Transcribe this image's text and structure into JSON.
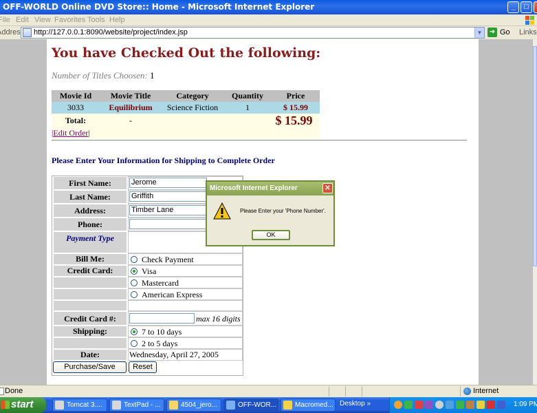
{
  "window": {
    "title": "OFF-WORLD Online DVD Store:: Home - Microsoft Internet Explorer"
  },
  "menu": [
    "File",
    "Edit",
    "View",
    "Favorites",
    "Tools",
    "Help"
  ],
  "address": {
    "label": "Address",
    "url": "http://127.0.0.1:8090/website/project/index.jsp",
    "go": "Go",
    "links": "Links"
  },
  "page": {
    "heading": "You have Checked Out the following:",
    "titles_label": "Number of Titles Choosen:",
    "titles_count": "1",
    "order": {
      "headers": [
        "Movie Id",
        "Movie Title",
        "Category",
        "Quantity",
        "Price"
      ],
      "rows": [
        {
          "id": "3033",
          "title": "Equilibrium",
          "category": "Science Fiction",
          "quantity": "1",
          "price": "$ 15.99"
        }
      ],
      "total_label": "Total:",
      "total_dash": "-",
      "total_amount": "$ 15.99",
      "edit_link": "Edit Order"
    },
    "shipping_heading": "Please Enter Your Information for Shipping to Complete Order",
    "form": {
      "first_name_label": "First Name:",
      "first_name_value": "Jerome",
      "last_name_label": "Last Name:",
      "last_name_value": "Griffith",
      "address_label": "Address:",
      "address_value": "Timber Lane",
      "phone_label": "Phone:",
      "phone_value": "",
      "payment_type_label": "Payment Type",
      "bill_me_label": "Bill Me:",
      "bill_me_option": "Check Payment",
      "credit_card_label": "Credit Card:",
      "card_options": [
        "Visa",
        "Mastercard",
        "American Express"
      ],
      "selected_card": "Visa",
      "cc_number_label": "Credit Card #:",
      "cc_number_value": "",
      "cc_hint": "max 16 digits",
      "shipping_label": "Shipping:",
      "shipping_options": [
        "7 to 10 days",
        "2 to 5 days"
      ],
      "selected_shipping": "7 to 10 days",
      "date_label": "Date:",
      "date_value": "Wednesday, April 27, 2005",
      "purchase_button": "Purchase/Save",
      "reset_button": "Reset"
    }
  },
  "dialog": {
    "title": "Microsoft Internet Explorer",
    "message": "Please Enter your 'Phone Number'.",
    "ok": "OK"
  },
  "status": {
    "text": "Done",
    "zone": "Internet"
  },
  "taskbar": {
    "start": "start",
    "tasks": [
      "Tomcat 3....",
      "TextPad - ...",
      "4504_jero...",
      "OFF-WOR...",
      "Macromed..."
    ],
    "desktop": "Desktop",
    "clock": "1:09 PM"
  },
  "colors": {
    "heading": "#8b1a1a",
    "navy": "#000080",
    "maroon": "#800000",
    "row_blue": "#add8e6",
    "row_cream": "#fffde6"
  }
}
